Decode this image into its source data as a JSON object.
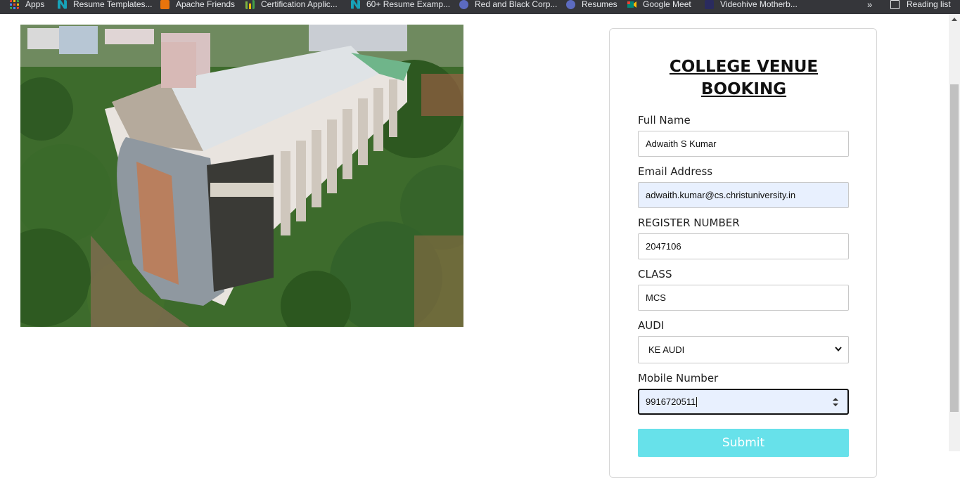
{
  "bookmarks": [
    {
      "label": "Apps",
      "icon": "apps-grid-icon"
    },
    {
      "label": "Resume Templates...",
      "icon": "n-logo-icon"
    },
    {
      "label": "Apache Friends",
      "icon": "apache-friends-icon"
    },
    {
      "label": "Certification Applic...",
      "icon": "bar-chart-icon"
    },
    {
      "label": "60+ Resume Examp...",
      "icon": "n-logo-icon"
    },
    {
      "label": "Red and Black Corp...",
      "icon": "canva-icon"
    },
    {
      "label": "Resumes",
      "icon": "canva-icon"
    },
    {
      "label": "Google Meet",
      "icon": "google-meet-icon"
    },
    {
      "label": "Videohive Motherb...",
      "icon": "ae-icon"
    }
  ],
  "bookmarks_more": "»",
  "reading_list": "Reading list",
  "form": {
    "title_line1": "COLLEGE VENUE",
    "title_line2": "BOOKING",
    "full_name_label": "Full Name",
    "full_name_value": "Adwaith S Kumar",
    "email_label": "Email Address",
    "email_value": "adwaith.kumar@cs.christuniversity.in",
    "register_label": "REGISTER NUMBER",
    "register_value": "2047106",
    "class_label": "CLASS",
    "class_value": "MCS",
    "audi_label": "AUDI",
    "audi_value": "KE AUDI",
    "mobile_label": "Mobile Number",
    "mobile_value": "9916720511",
    "submit_label": "Submit"
  },
  "colors": {
    "submit": "#67e1ea",
    "autofill": "#e8f0fe",
    "bookmarks_bar": "#35363a"
  }
}
